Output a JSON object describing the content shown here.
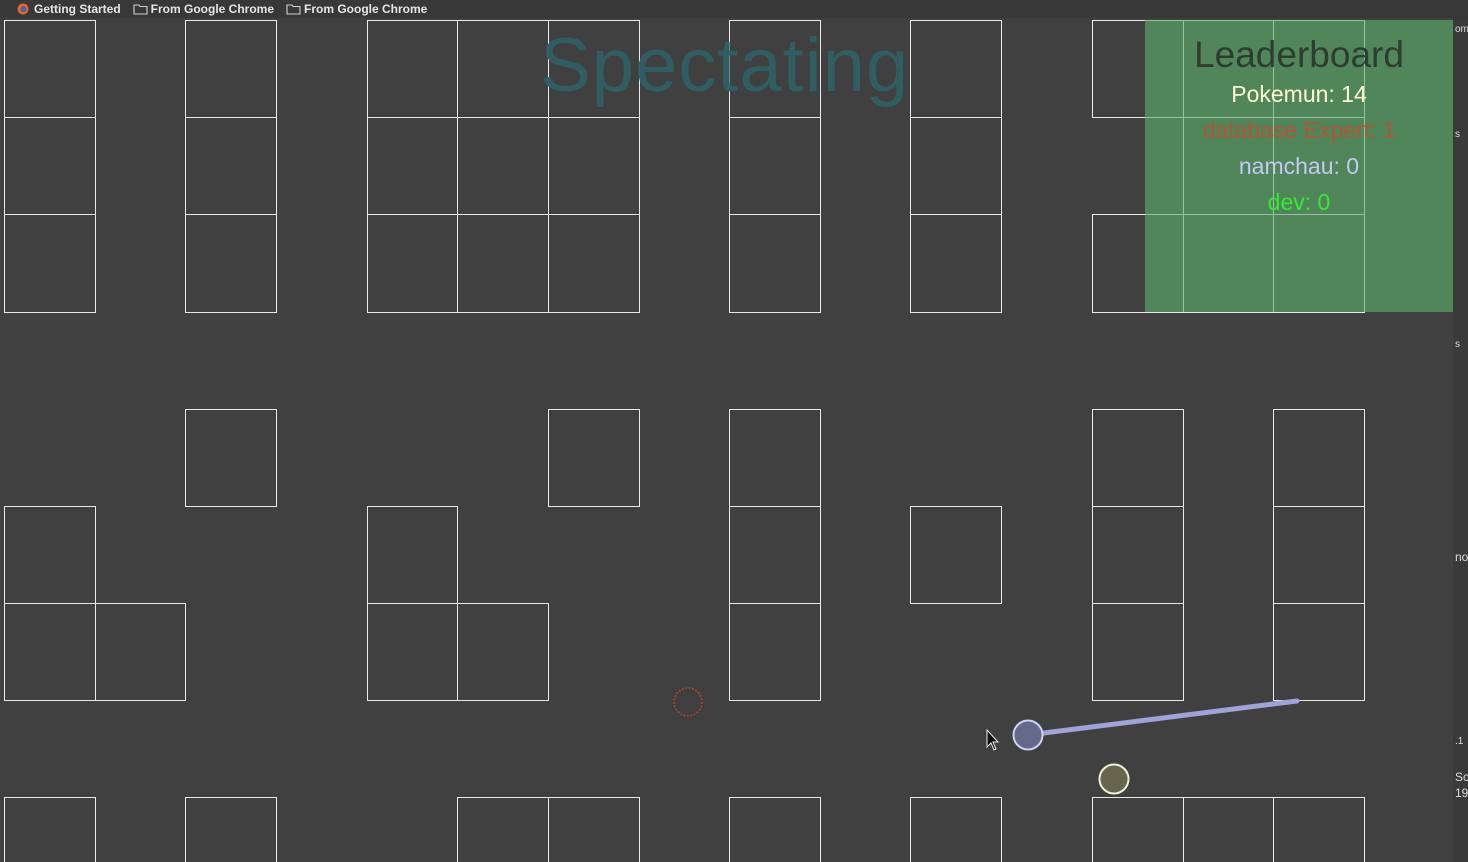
{
  "bookmarks": [
    {
      "label": "Getting Started",
      "icon": "firefox-icon"
    },
    {
      "label": "From Google Chrome",
      "icon": "folder-icon"
    },
    {
      "label": "From Google Chrome",
      "icon": "folder-icon"
    }
  ],
  "overlay": {
    "status_text": "Spectating"
  },
  "leaderboard": {
    "title": "Leaderboard",
    "entries": [
      {
        "text": "Pokemun: 14",
        "color": "#fffbd0"
      },
      {
        "text": "database Expert: 1",
        "color": "#b0563a"
      },
      {
        "text": "namchau: 0",
        "color": "#c4c8f2"
      },
      {
        "text": "dev: 0",
        "color": "#36e836"
      }
    ]
  },
  "game": {
    "colors": {
      "background": "#404040",
      "grid_lines": "#e8e8e8",
      "player_fill": "#656a8c",
      "player_stroke": "#cfd2f0",
      "aim_line": "#9fa3d6",
      "other_player_fill": "#66664e",
      "other_player_stroke": "#f0f0d8",
      "pickup_ring": "#c84030"
    }
  },
  "right_edge_text": [
    "om",
    "s",
    "s",
    "no",
    ".1",
    "Sc",
    "19"
  ]
}
